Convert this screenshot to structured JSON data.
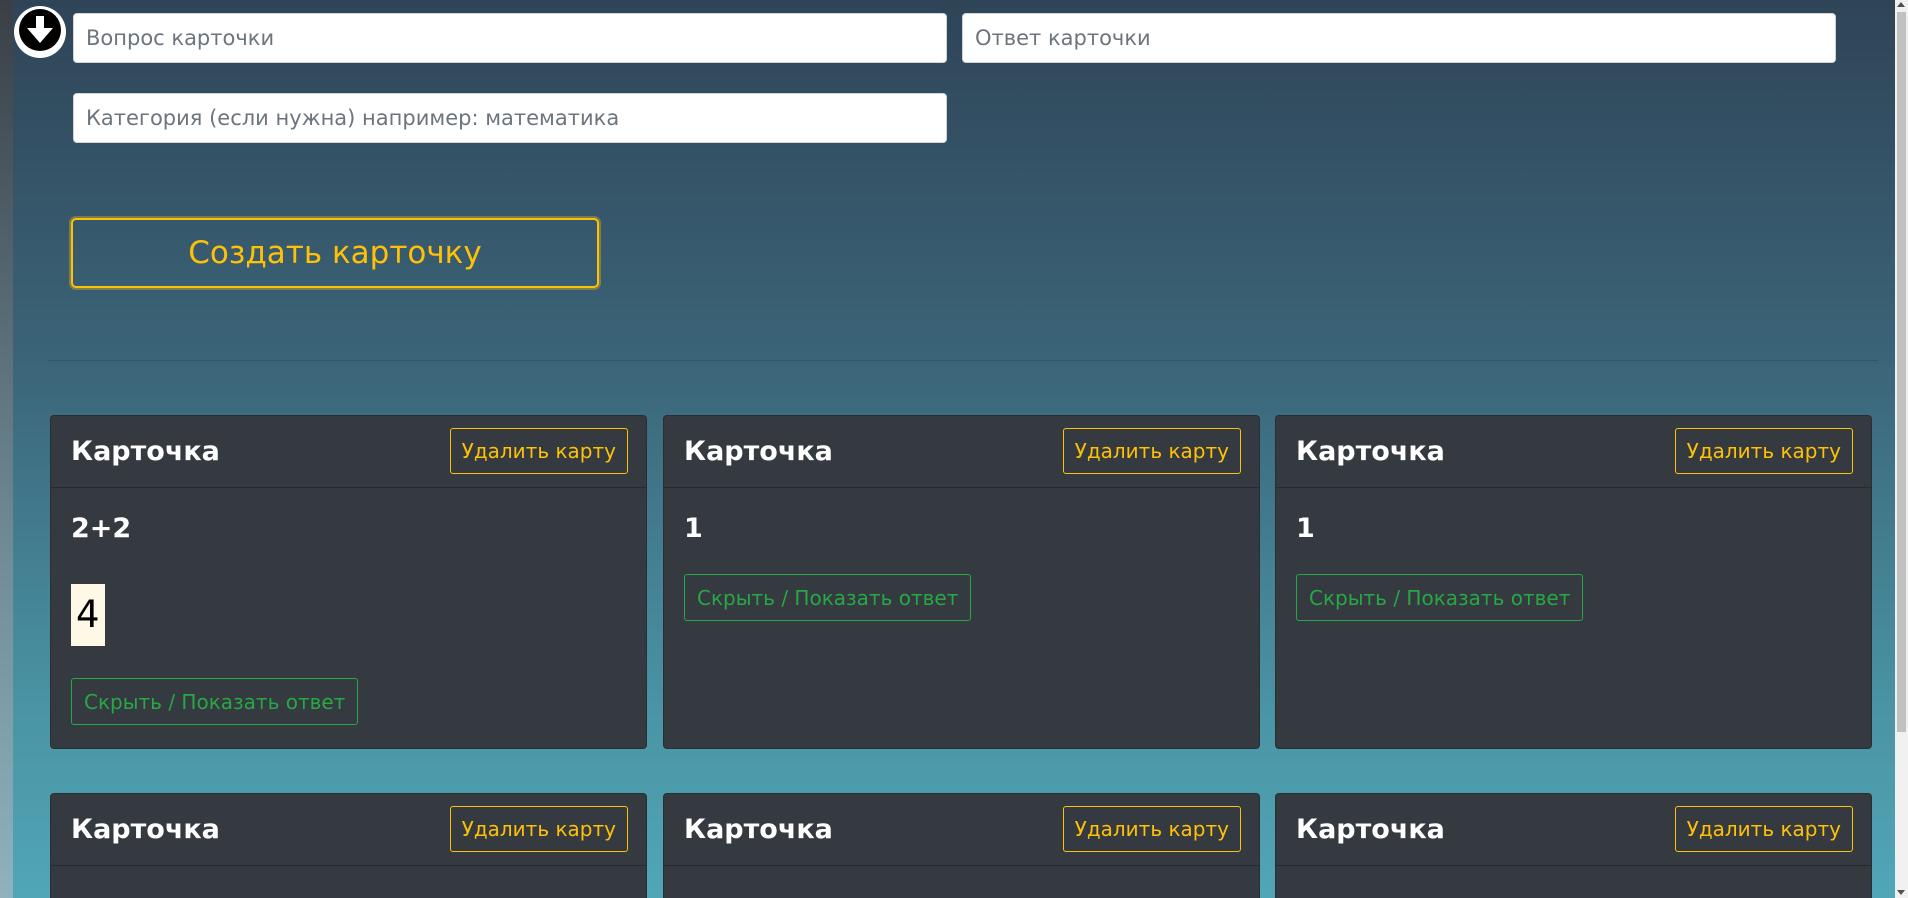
{
  "form": {
    "question_placeholder": "Вопрос карточки",
    "answer_placeholder": "Ответ карточки",
    "category_placeholder": "Категория (если нужна) например: математика",
    "create_label": "Создать карточку"
  },
  "cards": [
    {
      "title": "Карточка",
      "delete_label": "Удалить карту",
      "question": "2+2",
      "answer": "4",
      "toggle_label": "Скрыть / Показать ответ"
    },
    {
      "title": "Карточка",
      "delete_label": "Удалить карту",
      "question": "1",
      "toggle_label": "Скрыть / Показать ответ"
    },
    {
      "title": "Карточка",
      "delete_label": "Удалить карту",
      "question": "1",
      "toggle_label": "Скрыть / Показать ответ"
    },
    {
      "title": "Карточка",
      "delete_label": "Удалить карту"
    },
    {
      "title": "Карточка",
      "delete_label": "Удалить карту"
    },
    {
      "title": "Карточка",
      "delete_label": "Удалить карту"
    }
  ],
  "icons": {
    "scroll_down": "arrow-down-circle-icon"
  },
  "colors": {
    "accent": "#ffc107",
    "success": "#28a745",
    "card_bg": "#343a40"
  }
}
